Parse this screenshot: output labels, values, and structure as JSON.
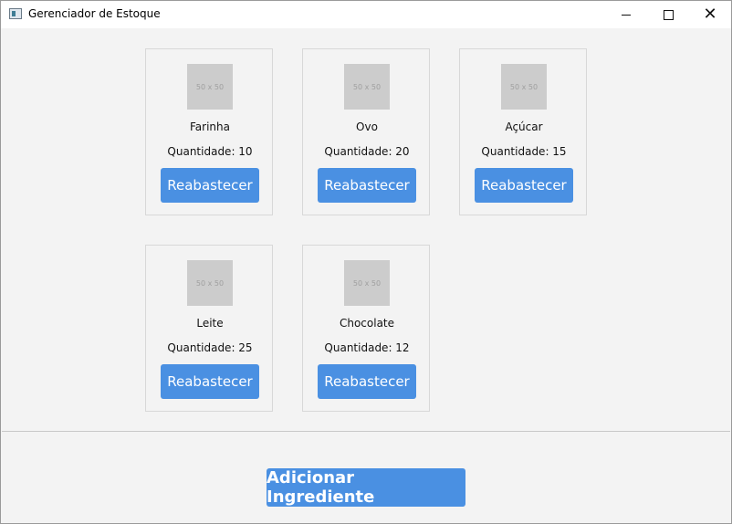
{
  "window": {
    "title": "Gerenciador de Estoque",
    "controls": {
      "minimize": "minimize",
      "maximize": "maximize",
      "close": "×"
    }
  },
  "thumbnail_text": "50 x 50",
  "qty_prefix": "Quantidade: ",
  "ingredients": [
    {
      "name": "Farinha",
      "quantity": "Quantidade: 10",
      "button": "Reabastecer"
    },
    {
      "name": "Ovo",
      "quantity": "Quantidade: 20",
      "button": "Reabastecer"
    },
    {
      "name": "Açúcar",
      "quantity": "Quantidade: 15",
      "button": "Reabastecer"
    },
    {
      "name": "Leite",
      "quantity": "Quantidade: 25",
      "button": "Reabastecer"
    },
    {
      "name": "Chocolate",
      "quantity": "Quantidade: 12",
      "button": "Reabastecer"
    }
  ],
  "footer": {
    "add_button": "Adicionar Ingrediente"
  },
  "colors": {
    "accent": "#4a90e2",
    "background": "#f3f3f3",
    "placeholder": "#cccccc"
  }
}
